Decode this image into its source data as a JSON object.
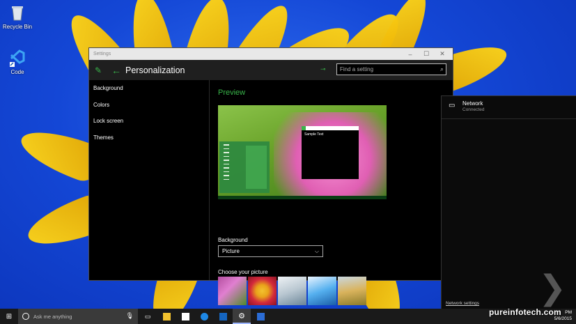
{
  "desktop": {
    "icons": [
      {
        "label": "Recycle Bin",
        "icon": "recycle-bin-icon"
      },
      {
        "label": "Code",
        "icon": "vscode-icon"
      }
    ]
  },
  "window": {
    "title": "Settings",
    "page_title": "Personalization",
    "search_placeholder": "Find a setting",
    "controls": {
      "minimize": "–",
      "maximize": "☐",
      "close": "✕"
    },
    "nav": [
      "Background",
      "Colors",
      "Lock screen",
      "Themes"
    ],
    "preview_heading": "Preview",
    "preview_sample_text": "Sample Text",
    "background_label": "Background",
    "background_value": "Picture",
    "choose_picture_label": "Choose your picture",
    "accent_color": "#39b54a"
  },
  "network": {
    "title": "Network",
    "status": "Connected",
    "settings_link": "Network settings"
  },
  "taskbar": {
    "search_placeholder": "Ask me anything",
    "time": "PM",
    "date": "5/6/2015"
  },
  "watermark": "pureinfotech.com"
}
